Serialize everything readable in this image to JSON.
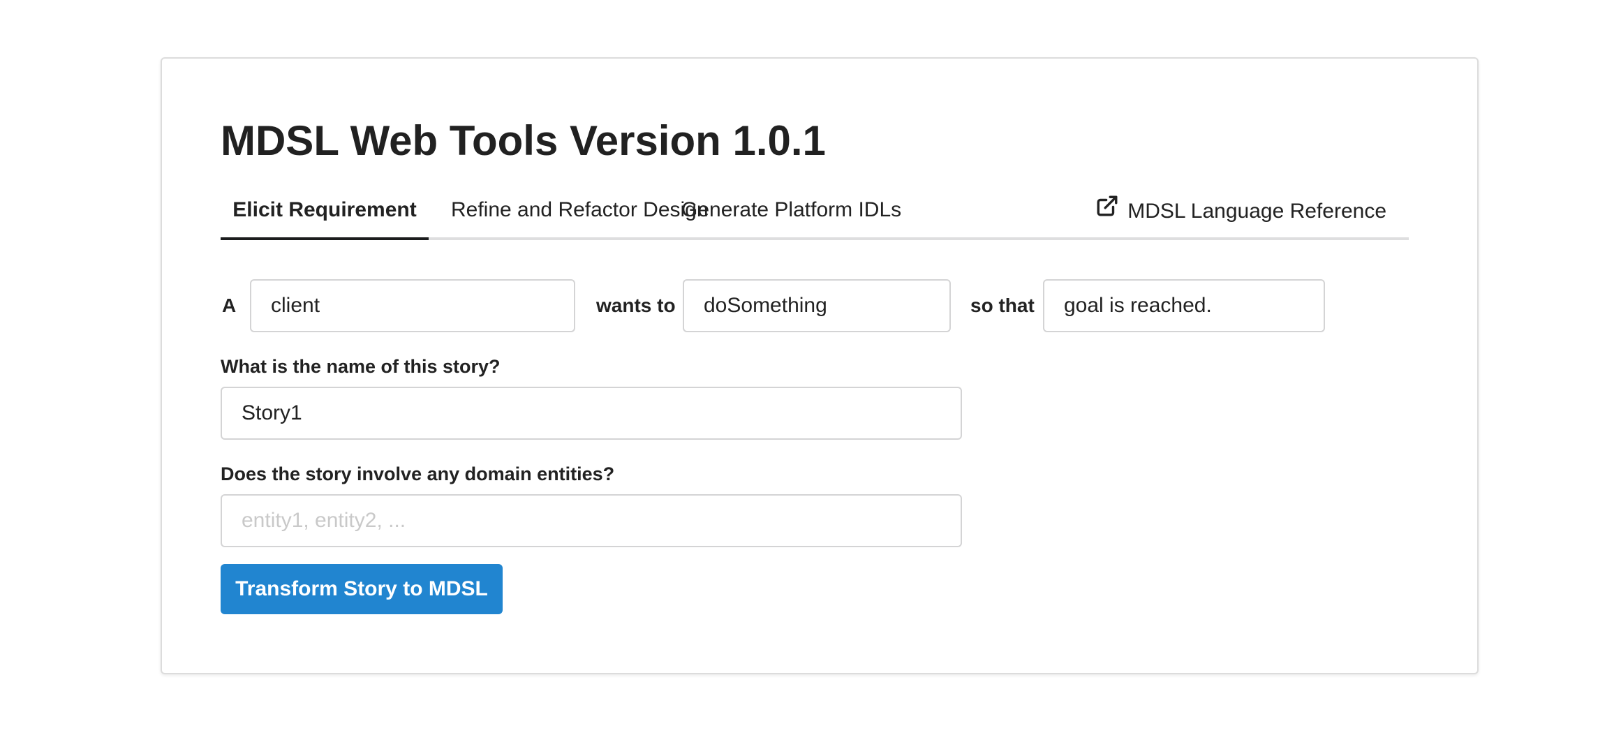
{
  "header": {
    "title": "MDSL Web Tools Version 1.0.1"
  },
  "tabs": [
    {
      "label": "Elicit Requirement",
      "active": true
    },
    {
      "label": "Refine and Refactor Design",
      "active": false
    },
    {
      "label": "Generate Platform IDLs",
      "active": false
    },
    {
      "label": "MDSL Language Reference",
      "active": false,
      "icon": "external-link-icon"
    }
  ],
  "story": {
    "role_prefix": "A",
    "role_value": "client",
    "wants_to_label": "wants to",
    "action_value": "doSomething",
    "so_that_label": "so that",
    "goal_value": "goal is reached.",
    "name_question": "What is the name of this story?",
    "name_value": "Story1",
    "entities_question": "Does the story involve any domain entities?",
    "entities_value": "",
    "entities_placeholder": "entity1, entity2, ...",
    "submit_label": "Transform Story to MDSL"
  },
  "colors": {
    "primary_button": "#2185d0",
    "active_tab_underline": "#1b1c1d",
    "tab_border": "#dededf"
  }
}
